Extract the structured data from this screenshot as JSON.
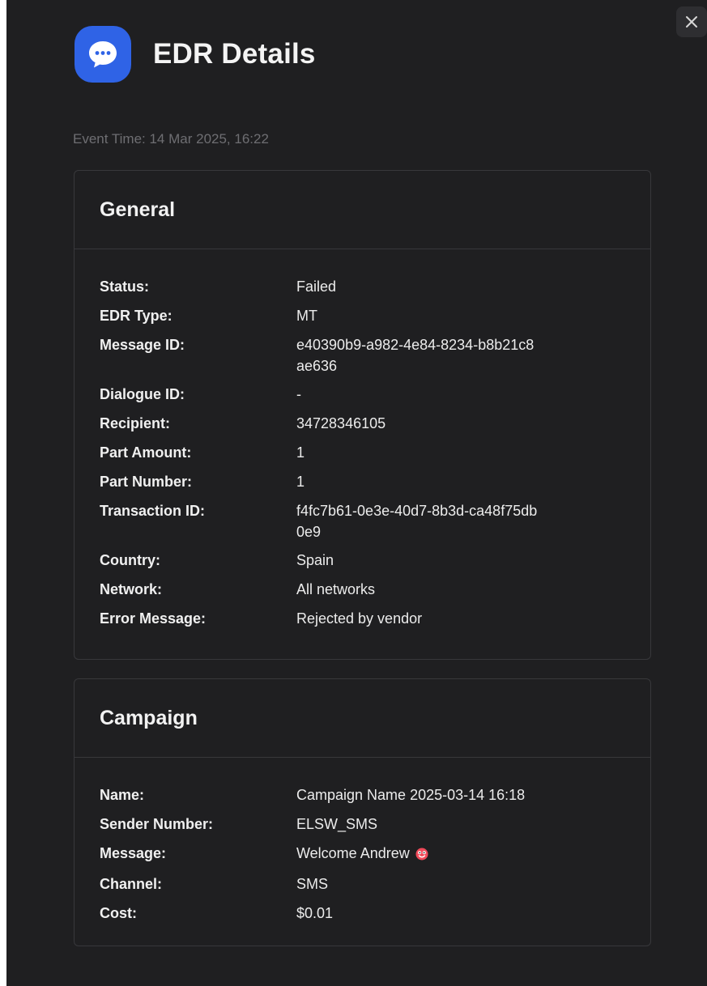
{
  "dialog": {
    "title": "EDR Details",
    "app_icon": "chat-bubble-icon",
    "close_icon": "close-icon",
    "event_time": "Event Time: 14 Mar 2025, 16:22",
    "accent_color": "#2f63e6",
    "background_color": "#1f1f21"
  },
  "general": {
    "title": "General",
    "rows": [
      {
        "label": "Status:",
        "value": "Failed"
      },
      {
        "label": "EDR Type:",
        "value": "MT"
      },
      {
        "label": "Message ID:",
        "value": "e40390b9-a982-4e84-8234-b8b21c8ae636"
      },
      {
        "label": "Dialogue ID:",
        "value": "-"
      },
      {
        "label": "Recipient:",
        "value": "34728346105"
      },
      {
        "label": "Part Amount:",
        "value": "1"
      },
      {
        "label": "Part Number:",
        "value": "1"
      },
      {
        "label": "Transaction ID:",
        "value": "f4fc7b61-0e3e-40d7-8b3d-ca48f75db0e9"
      },
      {
        "label": "Country:",
        "value": "Spain"
      },
      {
        "label": "Network:",
        "value": "All networks"
      },
      {
        "label": "Error Message:",
        "value": "Rejected by vendor"
      }
    ]
  },
  "campaign": {
    "title": "Campaign",
    "rows": [
      {
        "label": "Name:",
        "value": "Campaign Name 2025-03-14 16:18"
      },
      {
        "label": "Sender Number:",
        "value": "ELSW_SMS"
      },
      {
        "label": "Message:",
        "value": "Welcome Andrew",
        "emoji": "zany-face-emoji"
      },
      {
        "label": "Channel:",
        "value": "SMS"
      },
      {
        "label": "Cost:",
        "value": "$0.01"
      }
    ]
  }
}
